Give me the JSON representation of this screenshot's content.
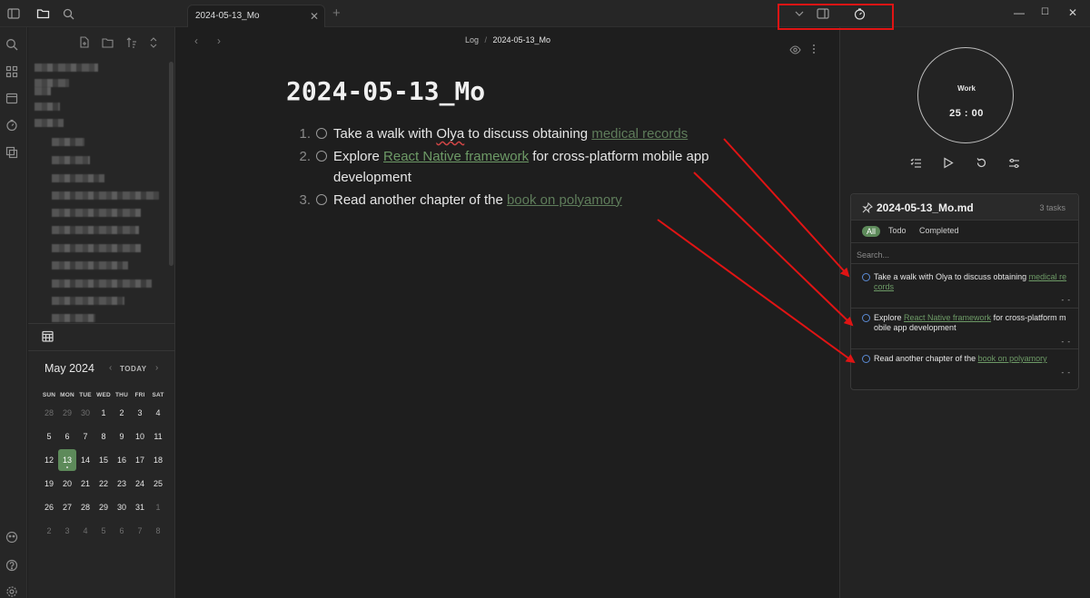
{
  "tab": {
    "title": "2024-05-13_Mo",
    "close": "✕",
    "new": "+"
  },
  "window": {
    "minimize": "—",
    "maximize": "☐",
    "close": "✕"
  },
  "editor": {
    "back": "‹",
    "forward": "›",
    "breadcrumb": {
      "folder": "Log",
      "separator": "/",
      "current": "2024-05-13_Mo"
    },
    "title": "2024-05-13_Mo",
    "tasks": [
      {
        "num": "1.",
        "pre": "Take a walk with ",
        "spell": "Olya",
        "mid": " to discuss obtaining ",
        "link": "medical records",
        "post": ""
      },
      {
        "num": "2.",
        "pre": "Explore ",
        "link": "React Native framework",
        "post": " for cross-platform mobile app development"
      },
      {
        "num": "3.",
        "pre": "Read another chapter of the ",
        "link": "book on polyamory",
        "post": ""
      }
    ]
  },
  "calendar": {
    "month": "May 2024",
    "today_label": "TODAY",
    "prev": "‹",
    "next": "›",
    "weekdays": [
      "SUN",
      "MON",
      "TUE",
      "WED",
      "THU",
      "FRI",
      "SAT"
    ],
    "weeks": [
      [
        "28",
        "29",
        "30",
        "1",
        "2",
        "3",
        "4"
      ],
      [
        "5",
        "6",
        "7",
        "8",
        "9",
        "10",
        "11"
      ],
      [
        "12",
        "13",
        "14",
        "15",
        "16",
        "17",
        "18"
      ],
      [
        "19",
        "20",
        "21",
        "22",
        "23",
        "24",
        "25"
      ],
      [
        "26",
        "27",
        "28",
        "29",
        "30",
        "31",
        "1"
      ],
      [
        "2",
        "3",
        "4",
        "5",
        "6",
        "7",
        "8"
      ]
    ],
    "today": "13"
  },
  "timer": {
    "label": "Work",
    "time": "25 : 00"
  },
  "tasks_panel": {
    "title": "2024-05-13_Mo.md",
    "count": "3 tasks",
    "filters": [
      "All",
      "Todo",
      "Completed"
    ],
    "search_placeholder": "Search...",
    "meta": "- -",
    "items": [
      {
        "pre": "Take a walk with Olya to discuss obtaining ",
        "link": "medical records",
        "post": ""
      },
      {
        "pre": "Explore ",
        "link": "React Native framework",
        "post": " for cross-platform mobile app development"
      },
      {
        "pre": "Read another chapter of the ",
        "link": "book on polyamory",
        "post": ""
      }
    ]
  },
  "colors": {
    "accent": "#5d8a5a",
    "link": "#6d9a66",
    "annotation": "#e01414",
    "task_circle": "#5b8bd6"
  }
}
